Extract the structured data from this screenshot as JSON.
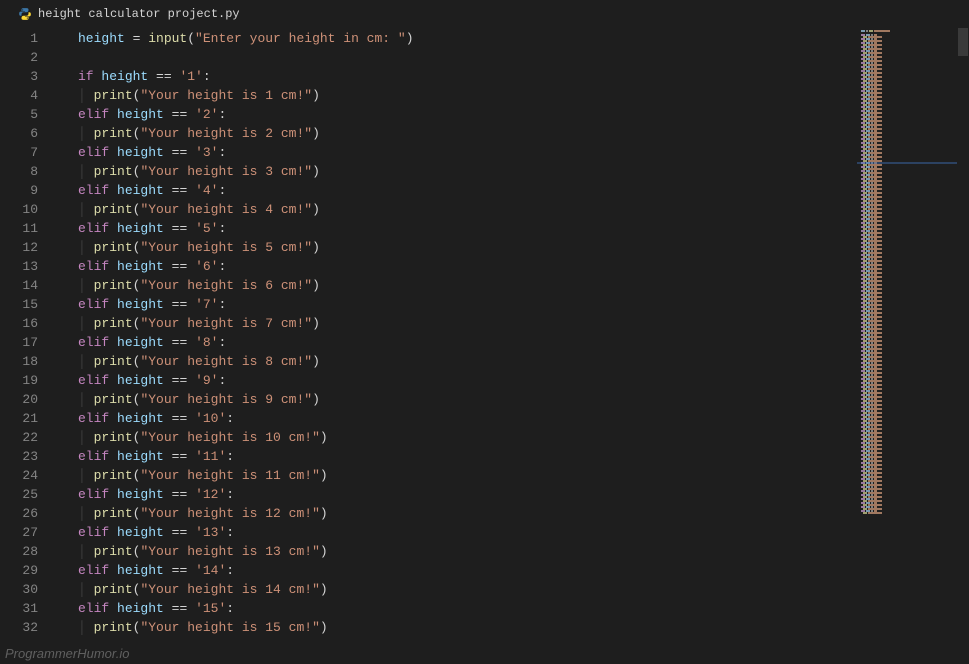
{
  "tab": {
    "filename": "height calculator project.py",
    "language": "python"
  },
  "watermark": "ProgrammerHumor.io",
  "colors": {
    "keyword": "#c586c0",
    "variable": "#9cdcfe",
    "function": "#dcdcaa",
    "string": "#ce9178",
    "gutter": "#858585",
    "background": "#1e1e1e"
  },
  "code_lines": [
    {
      "n": 1,
      "indent": 0,
      "type": "assign",
      "var": "height",
      "func": "input",
      "str": "\"Enter your height in cm: \""
    },
    {
      "n": 2,
      "indent": 0,
      "type": "blank"
    },
    {
      "n": 3,
      "indent": 0,
      "type": "if",
      "kw": "if",
      "var": "height",
      "cmp": "'1'"
    },
    {
      "n": 4,
      "indent": 1,
      "type": "print",
      "func": "print",
      "str": "\"Your height is 1 cm!\""
    },
    {
      "n": 5,
      "indent": 0,
      "type": "if",
      "kw": "elif",
      "var": "height",
      "cmp": "'2'"
    },
    {
      "n": 6,
      "indent": 1,
      "type": "print",
      "func": "print",
      "str": "\"Your height is 2 cm!\""
    },
    {
      "n": 7,
      "indent": 0,
      "type": "if",
      "kw": "elif",
      "var": "height",
      "cmp": "'3'"
    },
    {
      "n": 8,
      "indent": 1,
      "type": "print",
      "func": "print",
      "str": "\"Your height is 3 cm!\""
    },
    {
      "n": 9,
      "indent": 0,
      "type": "if",
      "kw": "elif",
      "var": "height",
      "cmp": "'4'"
    },
    {
      "n": 10,
      "indent": 1,
      "type": "print",
      "func": "print",
      "str": "\"Your height is 4 cm!\""
    },
    {
      "n": 11,
      "indent": 0,
      "type": "if",
      "kw": "elif",
      "var": "height",
      "cmp": "'5'"
    },
    {
      "n": 12,
      "indent": 1,
      "type": "print",
      "func": "print",
      "str": "\"Your height is 5 cm!\""
    },
    {
      "n": 13,
      "indent": 0,
      "type": "if",
      "kw": "elif",
      "var": "height",
      "cmp": "'6'"
    },
    {
      "n": 14,
      "indent": 1,
      "type": "print",
      "func": "print",
      "str": "\"Your height is 6 cm!\""
    },
    {
      "n": 15,
      "indent": 0,
      "type": "if",
      "kw": "elif",
      "var": "height",
      "cmp": "'7'"
    },
    {
      "n": 16,
      "indent": 1,
      "type": "print",
      "func": "print",
      "str": "\"Your height is 7 cm!\""
    },
    {
      "n": 17,
      "indent": 0,
      "type": "if",
      "kw": "elif",
      "var": "height",
      "cmp": "'8'"
    },
    {
      "n": 18,
      "indent": 1,
      "type": "print",
      "func": "print",
      "str": "\"Your height is 8 cm!\""
    },
    {
      "n": 19,
      "indent": 0,
      "type": "if",
      "kw": "elif",
      "var": "height",
      "cmp": "'9'"
    },
    {
      "n": 20,
      "indent": 1,
      "type": "print",
      "func": "print",
      "str": "\"Your height is 9 cm!\""
    },
    {
      "n": 21,
      "indent": 0,
      "type": "if",
      "kw": "elif",
      "var": "height",
      "cmp": "'10'"
    },
    {
      "n": 22,
      "indent": 1,
      "type": "print",
      "func": "print",
      "str": "\"Your height is 10 cm!\""
    },
    {
      "n": 23,
      "indent": 0,
      "type": "if",
      "kw": "elif",
      "var": "height",
      "cmp": "'11'"
    },
    {
      "n": 24,
      "indent": 1,
      "type": "print",
      "func": "print",
      "str": "\"Your height is 11 cm!\""
    },
    {
      "n": 25,
      "indent": 0,
      "type": "if",
      "kw": "elif",
      "var": "height",
      "cmp": "'12'"
    },
    {
      "n": 26,
      "indent": 1,
      "type": "print",
      "func": "print",
      "str": "\"Your height is 12 cm!\""
    },
    {
      "n": 27,
      "indent": 0,
      "type": "if",
      "kw": "elif",
      "var": "height",
      "cmp": "'13'"
    },
    {
      "n": 28,
      "indent": 1,
      "type": "print",
      "func": "print",
      "str": "\"Your height is 13 cm!\""
    },
    {
      "n": 29,
      "indent": 0,
      "type": "if",
      "kw": "elif",
      "var": "height",
      "cmp": "'14'"
    },
    {
      "n": 30,
      "indent": 1,
      "type": "print",
      "func": "print",
      "str": "\"Your height is 14 cm!\""
    },
    {
      "n": 31,
      "indent": 0,
      "type": "if",
      "kw": "elif",
      "var": "height",
      "cmp": "'15'"
    },
    {
      "n": 32,
      "indent": 1,
      "type": "print",
      "func": "print",
      "str": "\"Your height is 15 cm!\""
    }
  ]
}
